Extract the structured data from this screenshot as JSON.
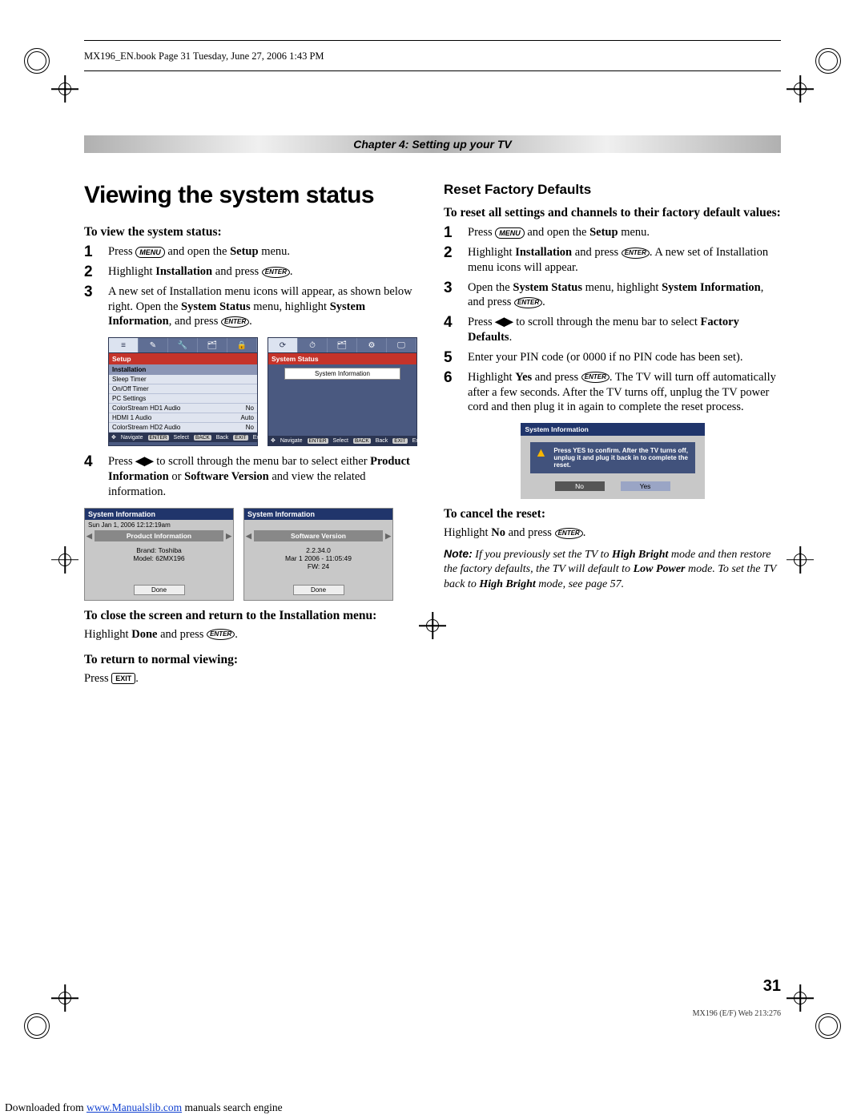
{
  "header_line": "MX196_EN.book  Page 31  Tuesday, June 27, 2006  1:43 PM",
  "chapter_bar": "Chapter 4: Setting up your TV",
  "left": {
    "title": "Viewing the system status",
    "sub1": "To view the system status:",
    "s1": "Press ",
    "s1b": " and open the ",
    "s1c": "Setup",
    "s1d": " menu.",
    "s2a": "Highlight ",
    "s2b": "Installation",
    "s2c": " and press ",
    "s3": "A new set of Installation menu icons will appear, as shown below right. Open the ",
    "s3b": "System Status",
    "s3c": " menu, highlight ",
    "s3d": "System Information",
    "s3e": ", and press ",
    "s4a": "Press ",
    "s4b": " to scroll through the menu bar to select either ",
    "s4c": "Product Information",
    "s4d": " or ",
    "s4e": "Software Version",
    "s4f": " and view the related information.",
    "close_head": "To close the screen and return to the Installation menu:",
    "close_body_a": "Highlight ",
    "close_body_b": "Done",
    "close_body_c": " and press ",
    "return_head": "To return to normal viewing:",
    "return_body": "Press ",
    "osd1": {
      "title": "Setup",
      "sub": "Installation",
      "rows": [
        [
          "Sleep Timer",
          ""
        ],
        [
          "On/Off Timer",
          ""
        ],
        [
          "PC Settings",
          ""
        ],
        [
          "ColorStream HD1 Audio",
          "No"
        ],
        [
          "HDMI 1 Audio",
          "Auto"
        ],
        [
          "ColorStream HD2 Audio",
          "No"
        ]
      ],
      "footer": [
        "Navigate",
        "Select",
        "Back",
        "Exit"
      ]
    },
    "osd2": {
      "title": "System Status",
      "btn": "System Information",
      "footer": [
        "Navigate",
        "Select",
        "Back",
        "Exit"
      ]
    },
    "grey1": {
      "hdr": "System Information",
      "date": "Sun Jan 1, 2006  12:12:19am",
      "tab": "Product Information",
      "lines": [
        "Brand:  Toshiba",
        "Model:  62MX196"
      ],
      "done": "Done"
    },
    "grey2": {
      "hdr": "System Information",
      "tab": "Software Version",
      "lines": [
        "2.2.34.0",
        "Mar 1 2006 - 11:05:49",
        "FW: 24"
      ],
      "done": "Done"
    }
  },
  "right": {
    "title": "Reset Factory Defaults",
    "sub": "To reset all settings and channels to their factory default values:",
    "s1a": "Press ",
    "s1b": " and open the ",
    "s1c": "Setup",
    "s1d": " menu.",
    "s2a": "Highlight ",
    "s2b": "Installation",
    "s2c": " and press ",
    "s2d": ". A new set of Installation menu icons will appear.",
    "s3a": "Open the ",
    "s3b": "System Status",
    "s3c": " menu, highlight ",
    "s3d": "System Information",
    "s3e": ", and press ",
    "s4a": "Press ",
    "s4b": " to scroll through the menu bar to select ",
    "s4c": "Factory Defaults",
    "s5": "Enter your PIN code (or 0000 if no PIN code has been set).",
    "s6a": "Highlight ",
    "s6b": "Yes",
    "s6c": " and press ",
    "s6d": ". The TV will turn off automatically after a few seconds. After the TV turns off, unplug the TV power cord and then plug it in again to complete the reset process.",
    "warn": {
      "hdr": "System Information",
      "msg": "Press YES to confirm. After the TV turns off, unplug it and plug it back in to complete the reset.",
      "no": "No",
      "yes": "Yes"
    },
    "cancel_head": "To cancel the reset:",
    "cancel_a": "Highlight ",
    "cancel_b": "No",
    "cancel_c": " and press ",
    "note_label": "Note:",
    "note_a": " If you previously set the TV to ",
    "note_b": "High Bright",
    "note_c": " mode and then restore the factory defaults, the TV will default to ",
    "note_d": "Low Power",
    "note_e": " mode. To set the TV back to ",
    "note_f": "High Bright",
    "note_g": " mode, see page 57."
  },
  "keys": {
    "menu": "MENU",
    "enter": "ENTER",
    "exit": "EXIT"
  },
  "page_num": "31",
  "foot_id": "MX196 (E/F) Web 213:276",
  "dl_prefix": "Downloaded from ",
  "dl_link": "www.Manualslib.com",
  "dl_suffix": " manuals search engine"
}
